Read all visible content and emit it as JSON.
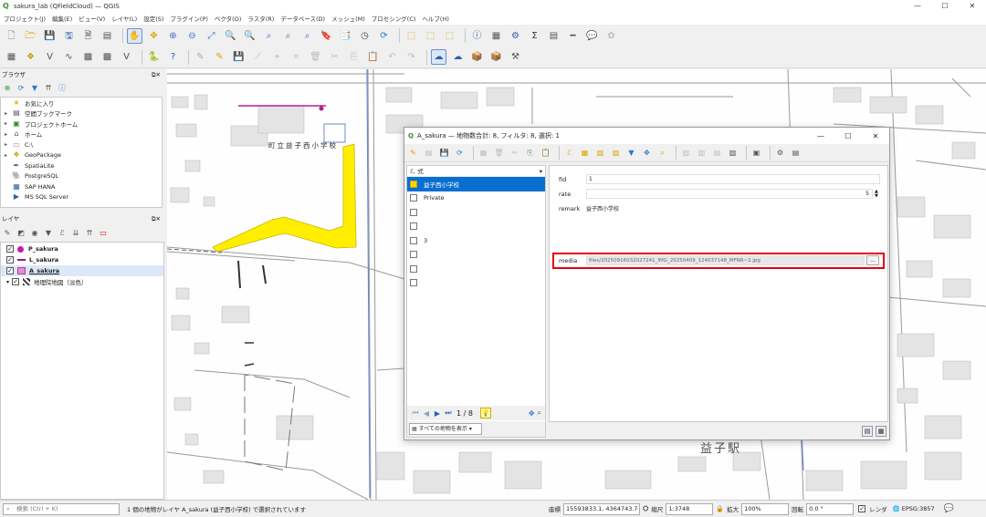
{
  "window": {
    "title": "sakura_lab (QFieldCloud) — QGIS",
    "minimize": "—",
    "maximize": "☐",
    "close": "✕"
  },
  "menu": [
    "プロジェクト(J)",
    "編集(E)",
    "ビュー(V)",
    "レイヤ(L)",
    "設定(S)",
    "プラグイン(P)",
    "ベクタ(O)",
    "ラスタ(R)",
    "データベース(D)",
    "メッシュ(M)",
    "プロセシング(C)",
    "ヘルプ(H)"
  ],
  "toolbar1_icons": [
    "new-project-icon",
    "open-project-icon",
    "save-project-icon",
    "save-as-icon",
    "print-layout-icon",
    "layout-manager-icon",
    "style-manager-icon",
    "pan-hand-icon",
    "pan-to-selection-icon",
    "zoom-in-icon",
    "zoom-out-icon",
    "zoom-full-icon",
    "zoom-selection-icon",
    "zoom-layer-icon",
    "zoom-native-icon",
    "zoom-last-icon",
    "zoom-next-icon",
    "new-bookmark-icon",
    "show-bookmarks-icon",
    "temporal-icon",
    "refresh-icon",
    "select-feature-icon",
    "deselect-icon",
    "select-by-location-icon",
    "identify-icon",
    "open-attribute-table-icon",
    "processing-toolbox-icon",
    "statistics-sum-icon",
    "attribute-table-icon",
    "measure-icon",
    "annotation-icon",
    "map-tips-icon"
  ],
  "toolbar2_icons": [
    "data-source-manager-icon",
    "new-geopackage-layer-icon",
    "digitize-icon",
    "edit-pencil-icon",
    "save-edits-icon",
    "add-feature-icon",
    "move-feature-icon",
    "node-tool-icon",
    "delete-selected-icon",
    "cut-icon",
    "copy-icon",
    "paste-icon",
    "undo-icon",
    "redo-icon",
    "python-icon",
    "help-icon",
    "qfieldcloud-icon",
    "qfieldcloud-sync-icon",
    "package-icon",
    "package-layers-icon",
    "hammer-icon"
  ],
  "browser": {
    "title": "ブラウザ",
    "items": [
      {
        "label": "お気に入り",
        "icon": "star-icon",
        "expandable": false
      },
      {
        "label": "空間ブックマーク",
        "icon": "bookmark-icon",
        "expandable": true
      },
      {
        "label": "プロジェクトホーム",
        "icon": "project-home-icon",
        "expandable": true
      },
      {
        "label": "ホーム",
        "icon": "home-folder-icon",
        "expandable": true
      },
      {
        "label": "C:\\",
        "icon": "drive-icon",
        "expandable": true
      },
      {
        "label": "GeoPackage",
        "icon": "geopackage-icon",
        "expandable": true
      },
      {
        "label": "SpatiaLite",
        "icon": "spatialite-icon",
        "expandable": false
      },
      {
        "label": "PostgreSQL",
        "icon": "postgresql-icon",
        "expandable": false
      },
      {
        "label": "SAP HANA",
        "icon": "sap-hana-icon",
        "expandable": false
      },
      {
        "label": "MS SQL Server",
        "icon": "mssql-icon",
        "expandable": false
      }
    ]
  },
  "layers": {
    "title": "レイヤ",
    "items": [
      {
        "label": "P_sakura",
        "symbol": "point",
        "color": "#c21bb0",
        "checked": true,
        "bold": true
      },
      {
        "label": "L_sakura",
        "symbol": "line",
        "color": "#8b1a87",
        "checked": true,
        "bold": true
      },
      {
        "label": "A_sakura",
        "symbol": "polygon",
        "color": "#f08ad9",
        "checked": true,
        "bold": true
      },
      {
        "label": "地理院地図（淡色）",
        "symbol": "raster",
        "color": "#444444",
        "checked": true,
        "bold": false
      }
    ]
  },
  "map": {
    "school_label": "町立益子西小学校",
    "station_label": "益子駅",
    "polygon_color": "#ffee00"
  },
  "dialog": {
    "title": "A_sakura — 地物数合計: 8, フィルタ: 8, 選択: 1",
    "expression_label": "ℰ, 式",
    "features": [
      {
        "label": "益子西小学校",
        "selected": true
      },
      {
        "label": "Private",
        "selected": false
      },
      {
        "label": "",
        "selected": false
      },
      {
        "label": "",
        "selected": false
      },
      {
        "label": "3",
        "selected": false
      },
      {
        "label": "",
        "selected": false
      },
      {
        "label": "",
        "selected": false
      },
      {
        "label": "",
        "selected": false
      }
    ],
    "nav_position": "1 / 8",
    "show_all_label": "すべての地物を表示",
    "attributes": {
      "fid_label": "fid",
      "fid_value": "1",
      "rate_label": "rate",
      "rate_value": "5",
      "remark_label": "remark",
      "remark_value": "益子西小学校",
      "media_label": "media",
      "media_value": "files/20250916032027241_IMG_20250409_124037148_MFNR~2.jpg",
      "media_button": "..."
    },
    "highlight_color": "#e8000e"
  },
  "status": {
    "search_placeholder": "検索 (Ctrl + K)",
    "message": "1 個の地物がレイヤ A_sakura (益子西小学校) で選択されています",
    "coord_label": "座標",
    "coord_value": "15593833.1, 4364743.7",
    "scale_label": "縮尺",
    "scale_value": "1:3748",
    "magnifier_label": "拡大",
    "magnifier_value": "100%",
    "rotation_label": "回転",
    "rotation_value": "0.0 °",
    "render_label": "レンダ",
    "crs_value": "EPSG:3857"
  }
}
